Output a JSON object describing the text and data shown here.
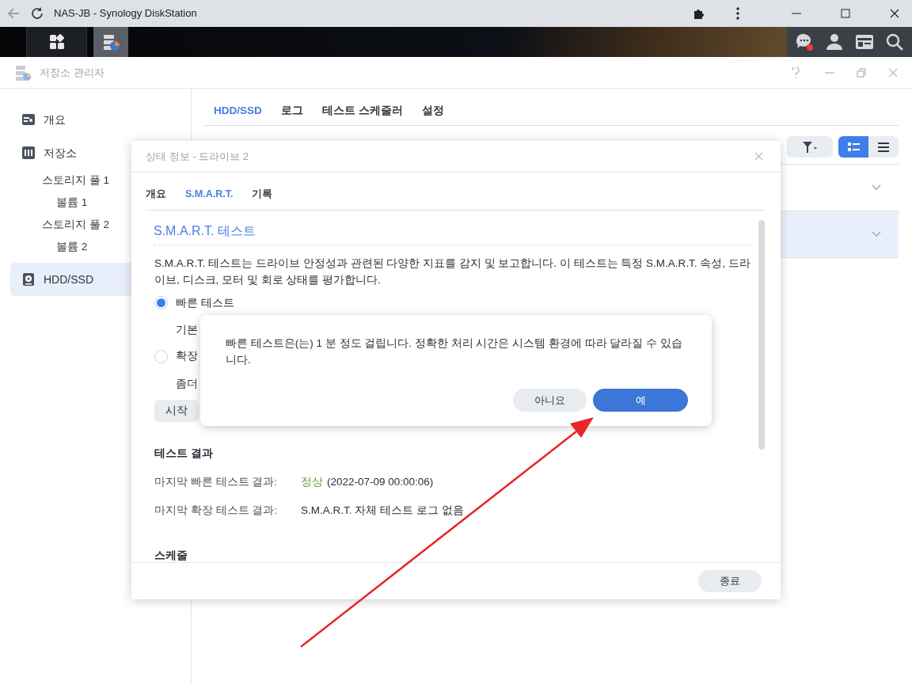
{
  "browser": {
    "title": "NAS-JB - Synology DiskStation"
  },
  "app": {
    "title": "저장소 관리자"
  },
  "sidebar": {
    "items": [
      {
        "label": "개요",
        "kind": "overview",
        "selected": false
      },
      {
        "label": "저장소",
        "kind": "storage",
        "selected": false,
        "children": [
          {
            "label": "스토리지 풀 1",
            "selected": false,
            "children": [
              {
                "label": "볼륨 1",
                "selected": false
              }
            ]
          },
          {
            "label": "스토리지 풀 2",
            "selected": false,
            "children": [
              {
                "label": "볼륨 2",
                "selected": false
              }
            ]
          }
        ]
      },
      {
        "label": "HDD/SSD",
        "kind": "disk",
        "selected": true
      }
    ]
  },
  "tabs": [
    {
      "label": "HDD/SSD",
      "selected": true
    },
    {
      "label": "로그",
      "selected": false
    },
    {
      "label": "테스트 스케줄러",
      "selected": false
    },
    {
      "label": "설정",
      "selected": false
    }
  ],
  "view_buttons": [
    {
      "kind": "cards",
      "selected": true
    },
    {
      "kind": "list",
      "selected": false
    }
  ],
  "drive_rows": [
    {
      "selected": false
    },
    {
      "selected": true
    }
  ],
  "dialog": {
    "title": "상태 정보 - 드라이브 2",
    "tabs": [
      {
        "label": "개요",
        "selected": false
      },
      {
        "label": "S.M.A.R.T.",
        "selected": true
      },
      {
        "label": "기록",
        "selected": false
      }
    ],
    "section_title": "S.M.A.R.T. 테스트",
    "description": "S.M.A.R.T. 테스트는 드라이브 안정성과 관련된 다양한 지표를 감지 및 보고합니다. 이 테스트는 특정 S.M.A.R.T. 속성, 드라이브, 디스크, 모터 및 회로 상태를 평가합니다.",
    "options": [
      {
        "label": "빠른 테스트",
        "selected": true,
        "description": "기본"
      },
      {
        "label": "확장",
        "selected": false,
        "description": "좀더"
      }
    ],
    "start_button": "시작",
    "results_title": "테스트 결과",
    "results": [
      {
        "label": "마지막 빠른 테스트 결과:",
        "status": "정상",
        "color": "#5fa33a",
        "value": "(2022-07-09 00:00:06)"
      },
      {
        "label": "마지막 확장 테스트 결과:",
        "value": "S.M.A.R.T. 자체 테스트 로그 없음"
      }
    ],
    "schedule_title": "스케줄",
    "close_button": "종료"
  },
  "confirm": {
    "message": "빠른 테스트은(는) 1 분 정도 걸립니다. 정확한 처리 시간은 시스템 환경에 따라 달라질 수 있습니다.",
    "buttons": [
      {
        "label": "아니요",
        "kind": "secondary"
      },
      {
        "label": "예",
        "kind": "primary"
      }
    ]
  }
}
